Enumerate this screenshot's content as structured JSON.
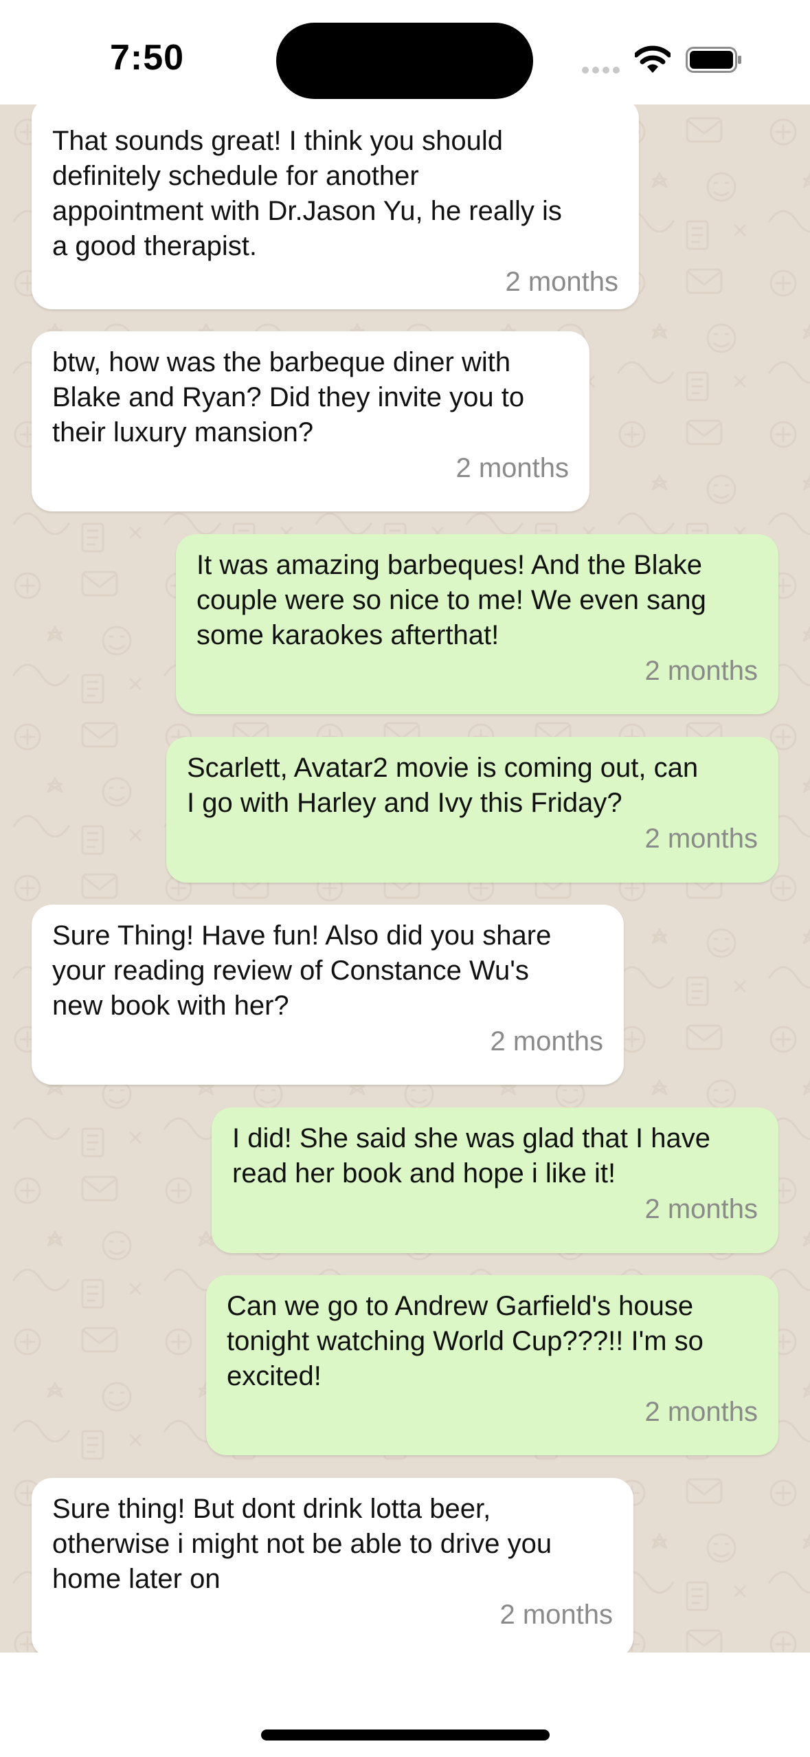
{
  "status_bar": {
    "time": "7:50"
  },
  "colors": {
    "incoming_bubble": "#ffffff",
    "outgoing_bubble": "#dbf7c5",
    "chat_background": "#e6ddd2",
    "timestamp": "#8a8a8a"
  },
  "icons": [
    "signal-dots-icon",
    "wifi-icon",
    "battery-icon"
  ],
  "messages": [
    {
      "direction": "incoming",
      "text": "That sounds great! I think you should\ndefinitely schedule for another\nappointment with Dr.Jason Yu, he really is\na good therapist.",
      "time": "2 months"
    },
    {
      "direction": "incoming",
      "text": "btw, how was the barbeque diner with\nBlake and Ryan? Did they invite you to\ntheir luxury mansion?",
      "time": "2 months"
    },
    {
      "direction": "outgoing",
      "text": "It was amazing barbeques! And the Blake\ncouple were so nice to me! We even sang\nsome karaokes afterthat!",
      "time": "2 months"
    },
    {
      "direction": "outgoing",
      "text": "Scarlett, Avatar2 movie is coming out, can\nI go with Harley and Ivy this Friday?",
      "time": "2 months"
    },
    {
      "direction": "incoming",
      "text": "Sure Thing! Have fun! Also did you share\nyour reading review of Constance Wu's\nnew book with her?",
      "time": "2 months"
    },
    {
      "direction": "outgoing",
      "text": "I did! She said she was glad that I have\nread her book and hope i like it!",
      "time": "2 months"
    },
    {
      "direction": "outgoing",
      "text": "Can we go to Andrew Garfield's house\ntonight watching World Cup???!! I'm so\nexcited!",
      "time": "2 months"
    },
    {
      "direction": "incoming",
      "text": "Sure thing! But dont drink lotta beer,\notherwise i might not be able to drive you\nhome later on",
      "time": "2 months"
    }
  ]
}
